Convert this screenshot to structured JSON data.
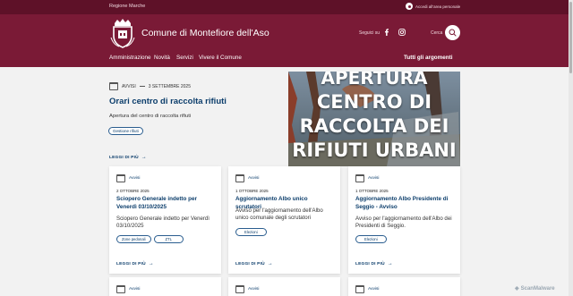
{
  "topbar": {
    "region": "Regione Marche",
    "login": "Accedi all'area personale"
  },
  "header": {
    "site_name": "Comune di Montefiore dell'Aso",
    "follow_label": "Seguici su",
    "search_label": "Cerca"
  },
  "nav": {
    "items": [
      "Amministrazione",
      "Novità",
      "Servizi",
      "Vivere il Comune"
    ],
    "all_topics": "Tutti gli argomenti"
  },
  "hero": {
    "category": "AVVISI",
    "date": "3 SETTEMBRE 2025",
    "title": "Orari centro di raccolta rifiuti",
    "description": "Apertura del centro di raccolta rifiuti",
    "tag": "Gestione rifiuti",
    "read_more": "LEGGI DI PIÙ",
    "image_lines": [
      "APERTURA",
      "CENTRO DI",
      "RACCOLTA DEI",
      "RIFIUTI URBANI"
    ]
  },
  "cards": [
    {
      "category": "Avvisi",
      "date": "2 OTTOBRE 2025",
      "title": "Sciopero Generale indetto per Venerdì 03/10/2025",
      "description": "Sciopero Generale indetto per Venerdì 03/10/2025",
      "tags": [
        "Zone pedonali",
        "ZTL"
      ],
      "read_more": "LEGGI DI PIÙ"
    },
    {
      "category": "Avvisi",
      "date": "1 OTTOBRE 2025",
      "title": "Aggiornamento Albo unico scrutatori",
      "description": "Avviso per l'aggiornamento dell'Albo unico comunale degli scrutatori",
      "tags": [
        "Elezioni"
      ],
      "read_more": "LEGGI DI PIÙ"
    },
    {
      "category": "Avvisi",
      "date": "1 OTTOBRE 2025",
      "title": "Aggiornamento Albo Presidente di Seggio - Avviso",
      "description": "Avviso per l'aggiornamento dell'Albo dei Presidenti di Seggio.",
      "tags": [
        "Elezioni"
      ],
      "read_more": "LEGGI DI PIÙ"
    }
  ],
  "next_cards": [
    {
      "category": "Avvisi"
    },
    {
      "category": "Avvisi"
    },
    {
      "category": "Avvisi"
    }
  ],
  "watermark": "ScanMalware",
  "colors": {
    "primary": "#7a1a36",
    "topbar": "#5e1128",
    "link": "#0b3d6b"
  }
}
